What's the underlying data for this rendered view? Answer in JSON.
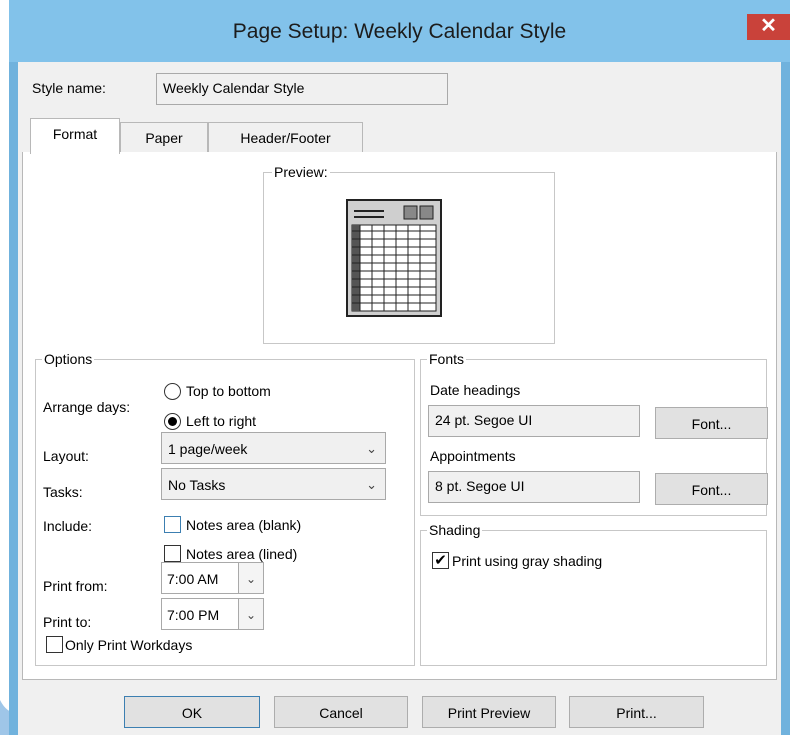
{
  "dialog": {
    "title": "Page Setup: Weekly Calendar Style",
    "close_glyph": "✕"
  },
  "style_name": {
    "label": "Style name:",
    "value": "Weekly Calendar Style"
  },
  "tabs": [
    {
      "label": "Format",
      "active": true
    },
    {
      "label": "Paper",
      "active": false
    },
    {
      "label": "Header/Footer",
      "active": false
    }
  ],
  "preview": {
    "label": "Preview:",
    "icon": "weekly-calendar-preview-icon"
  },
  "options": {
    "group_label": "Options",
    "arrange_days_label": "Arrange days:",
    "arrange_top_to_bottom": "Top to bottom",
    "arrange_left_to_right": "Left to right",
    "arrange_selected": "Left to right",
    "layout_label": "Layout:",
    "layout_value": "1 page/week",
    "tasks_label": "Tasks:",
    "tasks_value": "No Tasks",
    "include_label": "Include:",
    "notes_blank": "Notes area (blank)",
    "notes_blank_checked": false,
    "notes_lined": "Notes area (lined)",
    "notes_lined_checked": false,
    "print_from_label": "Print from:",
    "print_from_value": "7:00 AM",
    "print_to_label": "Print to:",
    "print_to_value": "7:00 PM",
    "only_workdays": "Only Print Workdays",
    "only_workdays_checked": false
  },
  "fonts": {
    "group_label": "Fonts",
    "date_headings_label": "Date headings",
    "date_headings_value": "24 pt. Segoe UI",
    "appointments_label": "Appointments",
    "appointments_value": "8 pt. Segoe UI",
    "font_button": "Font..."
  },
  "shading": {
    "group_label": "Shading",
    "gray_shading": "Print using gray shading",
    "gray_shading_checked": true,
    "check_glyph": "✔"
  },
  "buttons": {
    "ok": "OK",
    "cancel": "Cancel",
    "print_preview": "Print Preview",
    "print": "Print..."
  },
  "glyphs": {
    "dropdown_arrow": "⌄",
    "spin_arrow": "⌄"
  },
  "colors": {
    "title_bar": "#82c2ea",
    "close_button": "#c9423a",
    "focus_border": "#3c7fb1"
  }
}
